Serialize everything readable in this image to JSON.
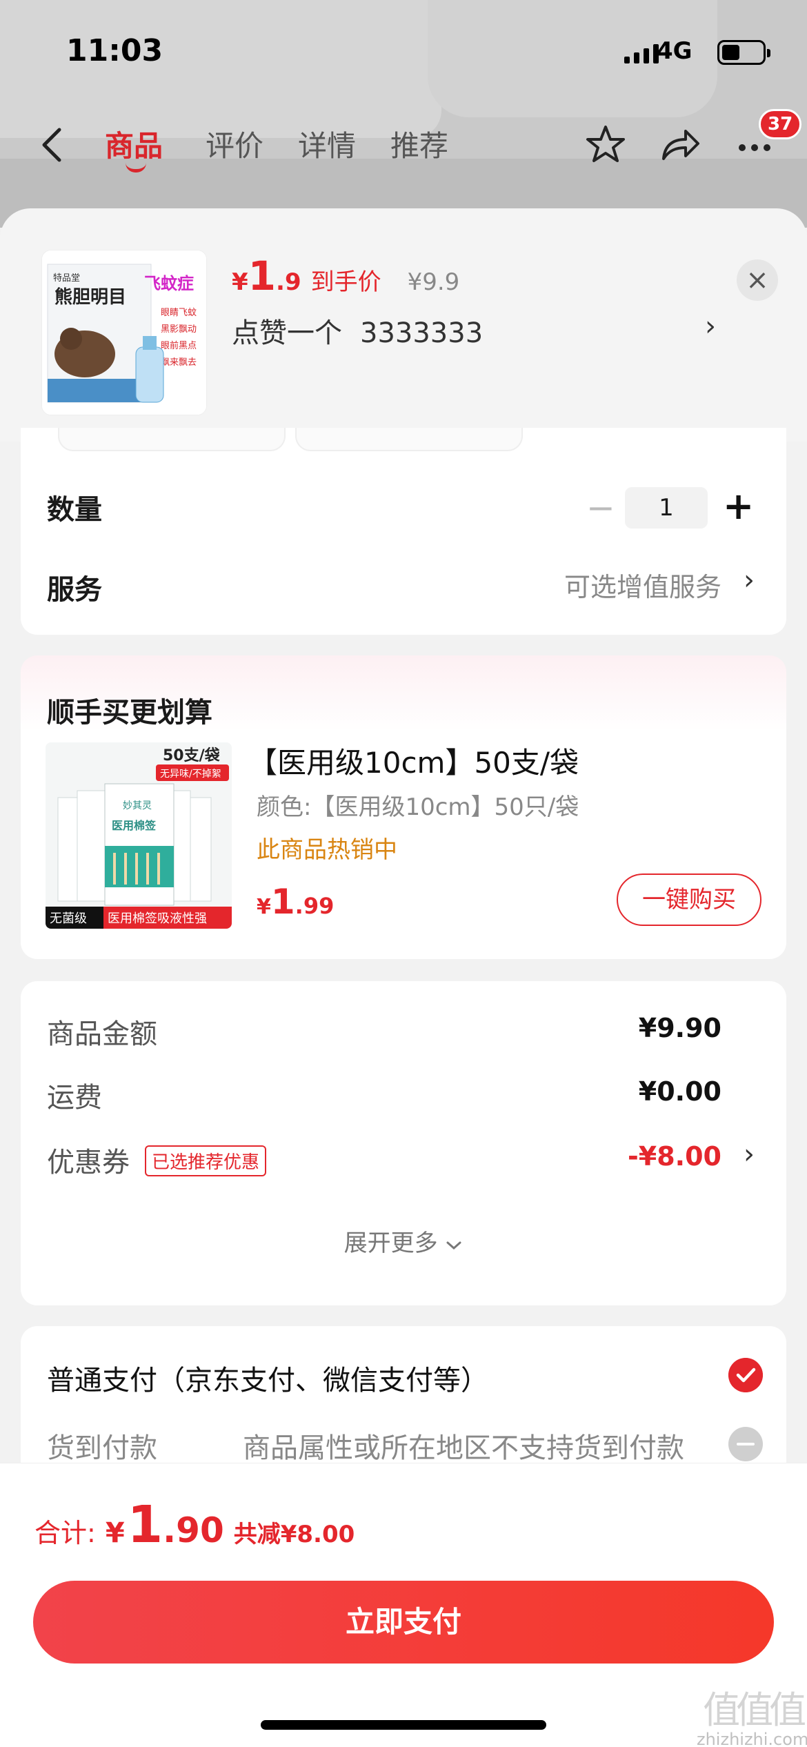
{
  "status_bar": {
    "time": "11:03",
    "network": "4G",
    "battery_level": 0.45
  },
  "top_nav": {
    "tabs": [
      "商品",
      "评价",
      "详情",
      "推荐"
    ],
    "active_tab": "商品",
    "cart_badge": "37",
    "icons": [
      "back-arrow-icon",
      "star-icon",
      "share-icon",
      "more-icon"
    ]
  },
  "product": {
    "thumb_title": "熊胆明目",
    "thumb_tagline": "飞蚊症",
    "thumb_points": [
      "眼睛飞蚊",
      "黑影飘动",
      "眼前黑点",
      "飘来飘去"
    ],
    "price_symbol": "¥",
    "price_int": "1",
    "price_dec": ".9",
    "price_tag": "到手价",
    "original_price": "¥9.9",
    "spec_text": "点赞一个",
    "spec_code": "3333333"
  },
  "quantity": {
    "label": "数量",
    "value": "1",
    "minus": "−",
    "plus": "+"
  },
  "service": {
    "label": "服务",
    "value": "可选增值服务"
  },
  "addon": {
    "title": "顺手买更划算",
    "name": "【医用级10cm】50支/袋",
    "color": "颜色:【医用级10cm】50只/袋",
    "hot": "此商品热销中",
    "price_symbol": "¥",
    "price_int": "1",
    "price_dec": ".99",
    "buy_label": "一键购买",
    "img_top_label": "50支/袋",
    "img_sub_label": "无异味/不掉絮",
    "img_brand": "妙其灵",
    "img_product": "医用棉签",
    "img_bottom_left": "无菌级",
    "img_bottom_right": "医用棉签吸液性强"
  },
  "summary": {
    "goods_label": "商品金额",
    "goods_value": "¥9.90",
    "shipping_label": "运费",
    "shipping_value": "¥0.00",
    "coupon_label": "优惠券",
    "coupon_chip": "已选推荐优惠",
    "coupon_value": "-¥8.00",
    "expand_label": "展开更多"
  },
  "payment": {
    "normal_label": "普通支付（京东支付、微信支付等）",
    "cod_label": "货到付款",
    "cod_note": "商品属性或所在地区不支持货到付款"
  },
  "bottom": {
    "total_label": "合计:",
    "total_symbol": "¥",
    "total_int": "1",
    "total_dec": ".90",
    "total_saved": "共减¥8.00",
    "pay_button": "立即支付",
    "watermark_text": "zhizhizhi.com",
    "watermark_mark": "值值值"
  },
  "colors": {
    "accent": "#e4262c",
    "hot": "#d98512",
    "muted": "#888888"
  }
}
